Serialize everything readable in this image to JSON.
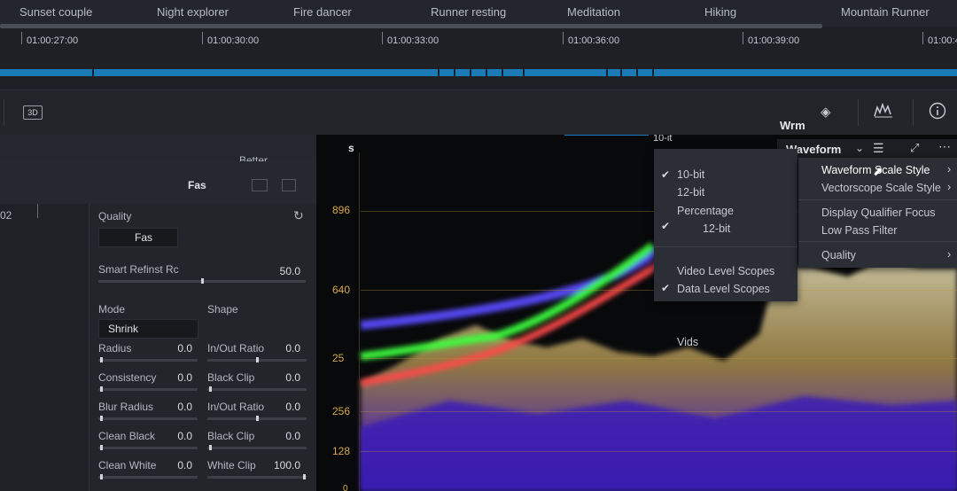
{
  "clip_tabs": [
    "Sunset couple",
    "Night explorer",
    "Fire dancer",
    "Runner resting",
    "Meditation",
    "Hiking",
    "Mountain Runner"
  ],
  "timecodes": [
    "01:00:27:00",
    "01:00:30:00",
    "01:00:33:00",
    "01:00:36:00",
    "01:00:39:00",
    "01:00:4"
  ],
  "toolbar": {
    "label_3d": "3D",
    "scope_title": "Wrm"
  },
  "left_panel": {
    "header_label": "Better",
    "subheader_label": "Fas",
    "row_number": "02",
    "quality": {
      "label": "Quality",
      "button": "Fas"
    },
    "smart_refine": {
      "label": "Smart Refinst Rc",
      "value": "50.0"
    },
    "mode_label": "Mode",
    "shape_label": "Shape",
    "mode_value": "Shrink",
    "rows": [
      {
        "left_label": "Radius",
        "left_value": "0.0",
        "right_label": "In/Out Ratio",
        "right_value": "0.0"
      },
      {
        "left_label": "Consistency",
        "left_value": "0.0",
        "right_label": "Black Clip",
        "right_value": "0.0"
      },
      {
        "left_label": "Blur Radius",
        "left_value": "0.0",
        "right_label": "In/Out Ratio",
        "right_value": "0.0"
      },
      {
        "left_label": "Clean Black",
        "left_value": "0.0",
        "right_label": "Black Clip",
        "right_value": "0.0"
      },
      {
        "left_label": "Clean White",
        "left_value": "0.0",
        "right_label": "White Clip",
        "right_value": "100.0"
      }
    ]
  },
  "scope": {
    "header_s": "s",
    "dropdown_label": "Waveform",
    "bit_label": "10-it",
    "y_labels": [
      "896",
      "640",
      "25",
      "256",
      "128",
      "0"
    ],
    "colors": {
      "red": "#ff4a4a",
      "green": "#3cff3c",
      "blue": "#5a4cff",
      "grid": "#d9a94a"
    }
  },
  "scale_menu": {
    "items": [
      "10-bit",
      "12-bit",
      "Percentage",
      "12-bit",
      "Video Level Scopes",
      "Data Level Scopes",
      "Vids"
    ],
    "checked": [
      "10-bit",
      "Data Level Scopes"
    ]
  },
  "scope_menu": {
    "items": [
      "Waveform Scale Style",
      "Vectorscope Scale Style",
      "Display Qualifier Focus",
      "Low Pass Filter",
      "Quality"
    ]
  }
}
